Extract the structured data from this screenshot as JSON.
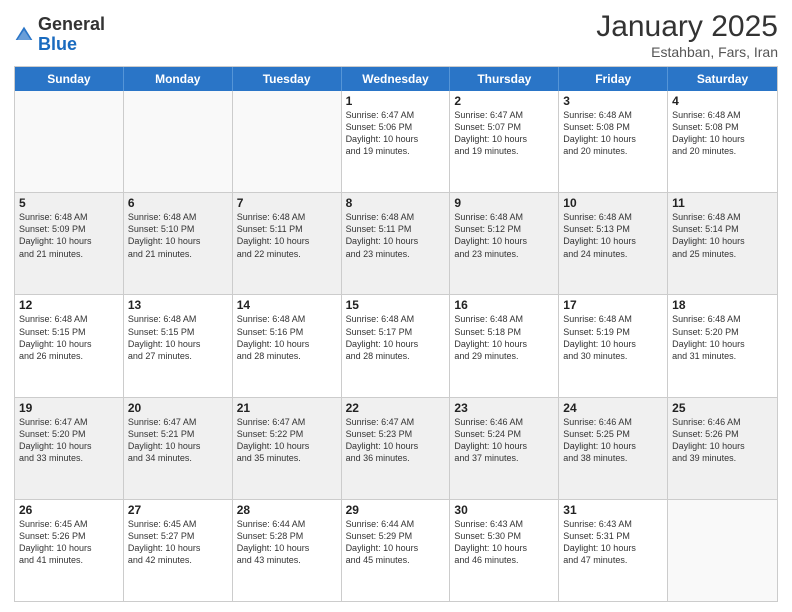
{
  "logo": {
    "general": "General",
    "blue": "Blue"
  },
  "title": "January 2025",
  "subtitle": "Estahban, Fars, Iran",
  "header": {
    "days": [
      "Sunday",
      "Monday",
      "Tuesday",
      "Wednesday",
      "Thursday",
      "Friday",
      "Saturday"
    ]
  },
  "weeks": [
    [
      {
        "day": "",
        "info": ""
      },
      {
        "day": "",
        "info": ""
      },
      {
        "day": "",
        "info": ""
      },
      {
        "day": "1",
        "info": "Sunrise: 6:47 AM\nSunset: 5:06 PM\nDaylight: 10 hours\nand 19 minutes."
      },
      {
        "day": "2",
        "info": "Sunrise: 6:47 AM\nSunset: 5:07 PM\nDaylight: 10 hours\nand 19 minutes."
      },
      {
        "day": "3",
        "info": "Sunrise: 6:48 AM\nSunset: 5:08 PM\nDaylight: 10 hours\nand 20 minutes."
      },
      {
        "day": "4",
        "info": "Sunrise: 6:48 AM\nSunset: 5:08 PM\nDaylight: 10 hours\nand 20 minutes."
      }
    ],
    [
      {
        "day": "5",
        "info": "Sunrise: 6:48 AM\nSunset: 5:09 PM\nDaylight: 10 hours\nand 21 minutes."
      },
      {
        "day": "6",
        "info": "Sunrise: 6:48 AM\nSunset: 5:10 PM\nDaylight: 10 hours\nand 21 minutes."
      },
      {
        "day": "7",
        "info": "Sunrise: 6:48 AM\nSunset: 5:11 PM\nDaylight: 10 hours\nand 22 minutes."
      },
      {
        "day": "8",
        "info": "Sunrise: 6:48 AM\nSunset: 5:11 PM\nDaylight: 10 hours\nand 23 minutes."
      },
      {
        "day": "9",
        "info": "Sunrise: 6:48 AM\nSunset: 5:12 PM\nDaylight: 10 hours\nand 23 minutes."
      },
      {
        "day": "10",
        "info": "Sunrise: 6:48 AM\nSunset: 5:13 PM\nDaylight: 10 hours\nand 24 minutes."
      },
      {
        "day": "11",
        "info": "Sunrise: 6:48 AM\nSunset: 5:14 PM\nDaylight: 10 hours\nand 25 minutes."
      }
    ],
    [
      {
        "day": "12",
        "info": "Sunrise: 6:48 AM\nSunset: 5:15 PM\nDaylight: 10 hours\nand 26 minutes."
      },
      {
        "day": "13",
        "info": "Sunrise: 6:48 AM\nSunset: 5:15 PM\nDaylight: 10 hours\nand 27 minutes."
      },
      {
        "day": "14",
        "info": "Sunrise: 6:48 AM\nSunset: 5:16 PM\nDaylight: 10 hours\nand 28 minutes."
      },
      {
        "day": "15",
        "info": "Sunrise: 6:48 AM\nSunset: 5:17 PM\nDaylight: 10 hours\nand 28 minutes."
      },
      {
        "day": "16",
        "info": "Sunrise: 6:48 AM\nSunset: 5:18 PM\nDaylight: 10 hours\nand 29 minutes."
      },
      {
        "day": "17",
        "info": "Sunrise: 6:48 AM\nSunset: 5:19 PM\nDaylight: 10 hours\nand 30 minutes."
      },
      {
        "day": "18",
        "info": "Sunrise: 6:48 AM\nSunset: 5:20 PM\nDaylight: 10 hours\nand 31 minutes."
      }
    ],
    [
      {
        "day": "19",
        "info": "Sunrise: 6:47 AM\nSunset: 5:20 PM\nDaylight: 10 hours\nand 33 minutes."
      },
      {
        "day": "20",
        "info": "Sunrise: 6:47 AM\nSunset: 5:21 PM\nDaylight: 10 hours\nand 34 minutes."
      },
      {
        "day": "21",
        "info": "Sunrise: 6:47 AM\nSunset: 5:22 PM\nDaylight: 10 hours\nand 35 minutes."
      },
      {
        "day": "22",
        "info": "Sunrise: 6:47 AM\nSunset: 5:23 PM\nDaylight: 10 hours\nand 36 minutes."
      },
      {
        "day": "23",
        "info": "Sunrise: 6:46 AM\nSunset: 5:24 PM\nDaylight: 10 hours\nand 37 minutes."
      },
      {
        "day": "24",
        "info": "Sunrise: 6:46 AM\nSunset: 5:25 PM\nDaylight: 10 hours\nand 38 minutes."
      },
      {
        "day": "25",
        "info": "Sunrise: 6:46 AM\nSunset: 5:26 PM\nDaylight: 10 hours\nand 39 minutes."
      }
    ],
    [
      {
        "day": "26",
        "info": "Sunrise: 6:45 AM\nSunset: 5:26 PM\nDaylight: 10 hours\nand 41 minutes."
      },
      {
        "day": "27",
        "info": "Sunrise: 6:45 AM\nSunset: 5:27 PM\nDaylight: 10 hours\nand 42 minutes."
      },
      {
        "day": "28",
        "info": "Sunrise: 6:44 AM\nSunset: 5:28 PM\nDaylight: 10 hours\nand 43 minutes."
      },
      {
        "day": "29",
        "info": "Sunrise: 6:44 AM\nSunset: 5:29 PM\nDaylight: 10 hours\nand 45 minutes."
      },
      {
        "day": "30",
        "info": "Sunrise: 6:43 AM\nSunset: 5:30 PM\nDaylight: 10 hours\nand 46 minutes."
      },
      {
        "day": "31",
        "info": "Sunrise: 6:43 AM\nSunset: 5:31 PM\nDaylight: 10 hours\nand 47 minutes."
      },
      {
        "day": "",
        "info": ""
      }
    ]
  ]
}
